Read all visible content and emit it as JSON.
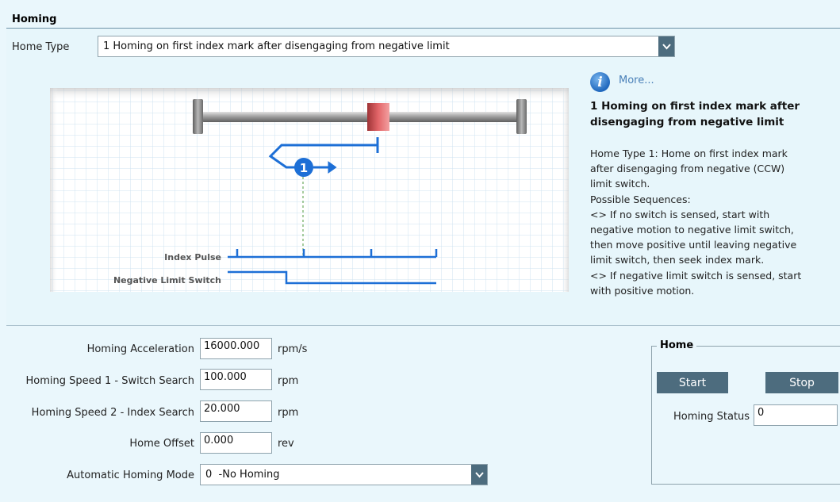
{
  "section_title": "Homing",
  "home_type": {
    "label": "Home Type",
    "selected": "1 Homing on first index mark after disengaging from negative limit"
  },
  "diagram": {
    "marker_label": "1",
    "signal_index_pulse": "Index Pulse",
    "signal_negative_limit": "Negative Limit Switch"
  },
  "info": {
    "icon": "info-icon",
    "more_link": "More...",
    "title_line1": "1 Homing on first index mark after",
    "title_line2": "disengaging from negative limit",
    "body_lines": [
      "Home Type 1: Home on first index mark",
      "after disengaging from negative (CCW)",
      "limit switch.",
      "Possible Sequences:",
      "<> If no switch is sensed, start with",
      "negative motion to negative limit switch,",
      "then move positive until leaving negative",
      "limit switch, then seek index mark.",
      "<> If negative limit switch is sensed, start",
      "with positive motion."
    ]
  },
  "params": {
    "acceleration": {
      "label": "Homing Acceleration",
      "value": "16000.000",
      "unit": "rpm/s"
    },
    "speed1": {
      "label": "Homing Speed 1 - Switch Search",
      "value": "100.000",
      "unit": "rpm"
    },
    "speed2": {
      "label": "Homing Speed 2 - Index Search",
      "value": "20.000",
      "unit": "rpm"
    },
    "offset": {
      "label": "Home Offset",
      "value": "0.000",
      "unit": "rev"
    },
    "auto_mode": {
      "label": "Automatic Homing Mode",
      "selected": "0  -No Homing"
    }
  },
  "home_group": {
    "title": "Home",
    "start_label": "Start",
    "stop_label": "Stop",
    "status_label": "Homing Status",
    "status_value": "0"
  },
  "colors": {
    "background": "#eaf7fc",
    "button": "#4d6c7e",
    "accent_blue": "#1d6fd6",
    "slider_red": "#e0575b",
    "link": "#4a80b8"
  }
}
